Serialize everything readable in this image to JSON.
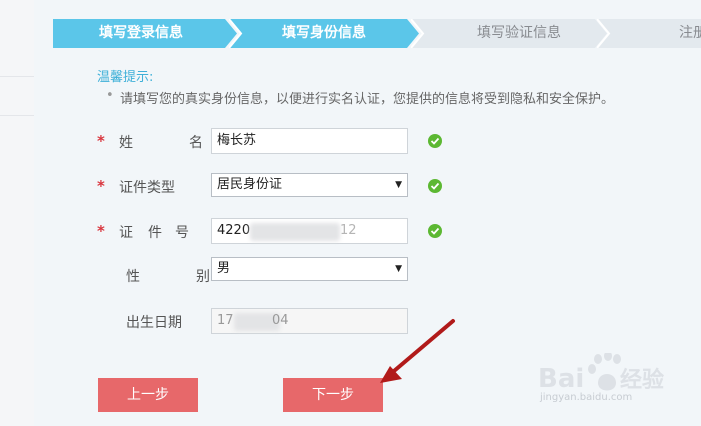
{
  "steps": [
    {
      "label": "填写登录信息",
      "state": "done"
    },
    {
      "label": "填写身份信息",
      "state": "current"
    },
    {
      "label": "填写验证信息",
      "state": "todo"
    },
    {
      "label": "注册",
      "state": "todo"
    }
  ],
  "tip": {
    "title": "温馨提示:",
    "bullet": "•",
    "text": "请填写您的真实身份信息，以便进行实名认证，您提供的信息将受到隐私和安全保护。"
  },
  "form": {
    "name": {
      "required": "*",
      "label_left": "姓",
      "label_right": "名",
      "value": "梅长苏"
    },
    "id_type": {
      "required": "*",
      "label": "证件类型",
      "value": "居民身份证",
      "caret": "▼"
    },
    "id_number": {
      "required": "*",
      "label_chars": [
        "证",
        "件",
        "号"
      ],
      "value_start": "4220",
      "value_end": "12"
    },
    "gender": {
      "label_left": "性",
      "label_right": "别",
      "value": "男",
      "caret": "▼"
    },
    "birthday": {
      "label": "出生日期",
      "value_start": "17",
      "value_end": "04"
    }
  },
  "buttons": {
    "prev": "上一步",
    "next": "下一步"
  },
  "watermark": {
    "brand": "Bai 经验",
    "url": "jingyan.baidu.com"
  },
  "colors": {
    "step_active": "#5bc6e9",
    "step_inactive": "#e3e9ee",
    "button": "#e7686a",
    "ok": "#5cb832",
    "required": "#d9363e",
    "tip_title": "#3fb0d8",
    "arrow": "#b11a1a"
  }
}
